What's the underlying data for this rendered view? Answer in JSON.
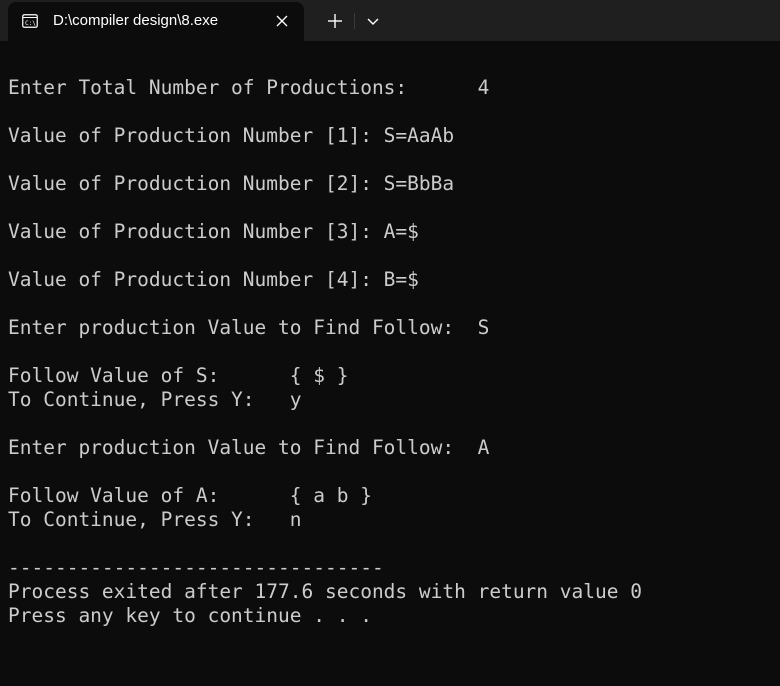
{
  "titlebar": {
    "tab_title": "D:\\compiler design\\8.exe",
    "tab_icon": "console-app-icon",
    "close_icon": "close-icon",
    "new_tab_icon": "plus-icon",
    "dropdown_icon": "chevron-down-icon"
  },
  "console": {
    "lines": [
      "Enter Total Number of Productions:      4",
      "",
      "Value of Production Number [1]: S=AaAb",
      "",
      "Value of Production Number [2]: S=BbBa",
      "",
      "Value of Production Number [3]: A=$",
      "",
      "Value of Production Number [4]: B=$",
      "",
      "Enter production Value to Find Follow:  S",
      "",
      "Follow Value of S:      { $ }",
      "To Continue, Press Y:   y",
      "",
      "Enter production Value to Find Follow:  A",
      "",
      "Follow Value of A:      { a b }",
      "To Continue, Press Y:   n",
      "",
      "--------------------------------",
      "Process exited after 177.6 seconds with return value 0",
      "Press any key to continue . . ."
    ]
  },
  "colors": {
    "background": "#0c0c0c",
    "titlebar": "#1f1f1f",
    "text": "#cccccc"
  }
}
